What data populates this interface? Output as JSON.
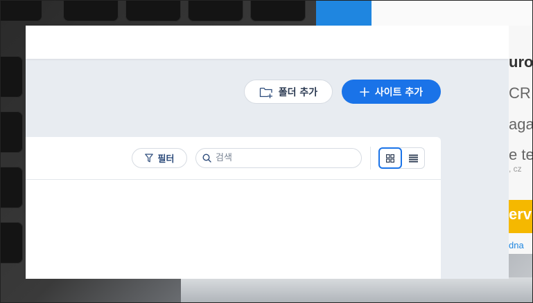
{
  "header": {
    "add_folder_label": "폴더 추가",
    "add_site_label": "사이트 추가"
  },
  "toolbar": {
    "filter_label": "필터",
    "search_placeholder": "검색",
    "search_value": "",
    "view_mode": "grid"
  },
  "icons": {
    "add_folder": "folder-plus-icon",
    "add_site": "plus-icon",
    "filter": "filter-icon",
    "search": "search-icon",
    "grid_view": "grid-icon",
    "list_view": "list-icon"
  },
  "background_text": [
    "uro",
    "CR",
    "aga",
    "e te",
    ", cz",
    "erv",
    "dna"
  ],
  "colors": {
    "accent": "#1a73e8",
    "page_bg": "#e8ecf1",
    "panel_bg": "#ffffff",
    "text_dark": "#2b3a52"
  }
}
